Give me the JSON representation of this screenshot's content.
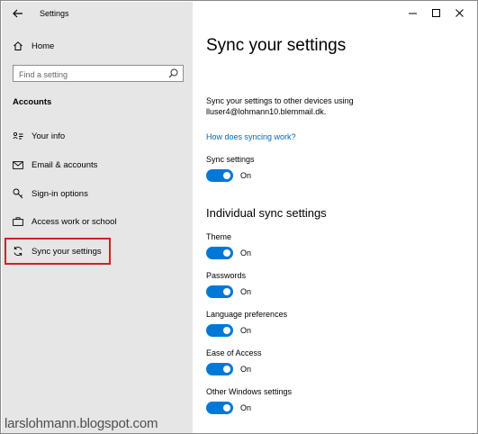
{
  "window": {
    "title": "Settings"
  },
  "sidebar": {
    "home_label": "Home",
    "search_placeholder": "Find a setting",
    "section_title": "Accounts",
    "items": [
      {
        "label": "Your info",
        "icon": "contact-card-icon"
      },
      {
        "label": "Email & accounts",
        "icon": "mail-icon"
      },
      {
        "label": "Sign-in options",
        "icon": "key-icon"
      },
      {
        "label": "Access work or school",
        "icon": "briefcase-icon"
      },
      {
        "label": "Sync your settings",
        "icon": "sync-icon",
        "selected": true
      }
    ]
  },
  "main": {
    "title": "Sync your settings",
    "description": "Sync your settings to other devices using lluser4@lohmann10.blemmail.dk.",
    "link": "How does syncing work?",
    "sync_settings": {
      "label": "Sync settings",
      "state": "On"
    },
    "individual_heading": "Individual sync settings",
    "individual": [
      {
        "label": "Theme",
        "state": "On"
      },
      {
        "label": "Passwords",
        "state": "On"
      },
      {
        "label": "Language preferences",
        "state": "On"
      },
      {
        "label": "Ease of Access",
        "state": "On"
      },
      {
        "label": "Other Windows settings",
        "state": "On"
      }
    ]
  },
  "watermark": "larslohmann.blogspot.com",
  "colors": {
    "accent": "#0078d7",
    "link": "#0067b8",
    "sidebar_bg": "#e6e6e6",
    "highlight_border": "#d11f2c"
  }
}
